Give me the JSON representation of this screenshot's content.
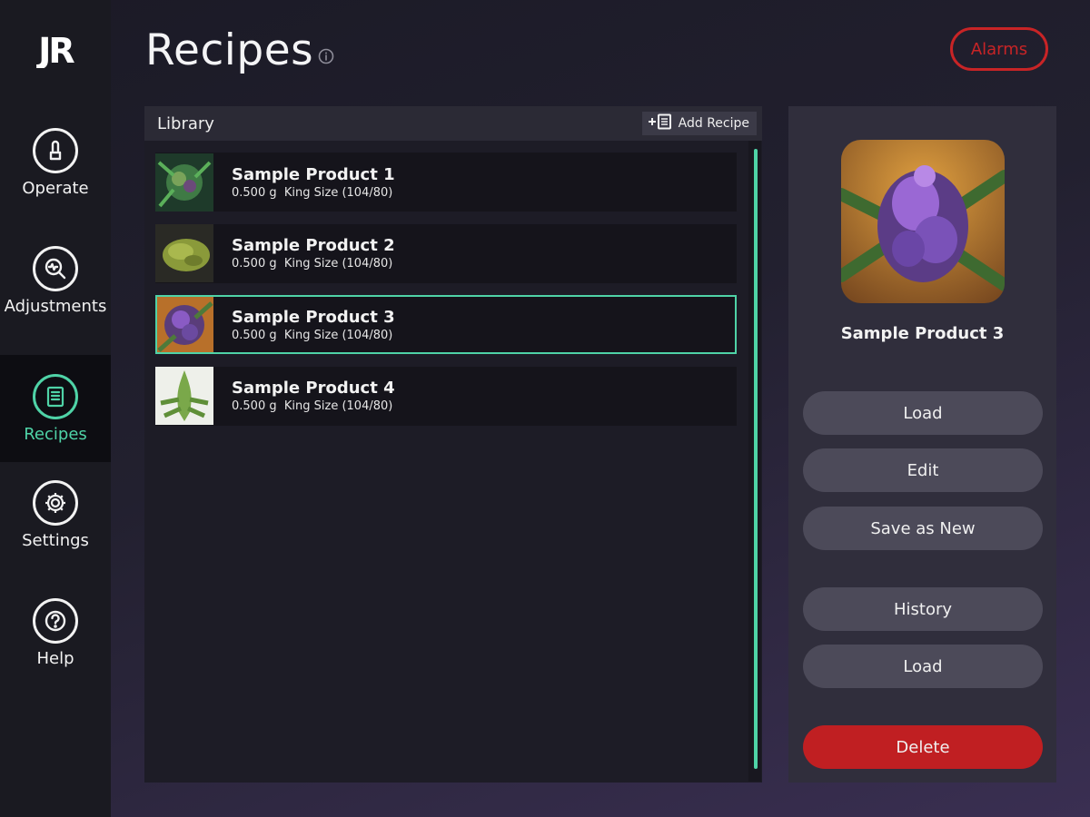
{
  "app": {
    "logo_text": "JR"
  },
  "sidebar": {
    "items": [
      {
        "label": "Operate",
        "icon": "operate-hand-icon"
      },
      {
        "label": "Adjustments",
        "icon": "adjustments-magnifier-icon"
      },
      {
        "label": "Recipes",
        "icon": "recipes-list-icon",
        "active": true
      },
      {
        "label": "Settings",
        "icon": "gear-icon"
      },
      {
        "label": "Help",
        "icon": "question-icon"
      }
    ]
  },
  "header": {
    "title": "Recipes",
    "alarms_label": "Alarms"
  },
  "library": {
    "title": "Library",
    "add_label": "Add Recipe",
    "items": [
      {
        "name": "Sample Product 1",
        "weight": "0.500 g",
        "size": "King Size (104/80)"
      },
      {
        "name": "Sample Product 2",
        "weight": "0.500 g",
        "size": "King Size (104/80)"
      },
      {
        "name": "Sample Product 3",
        "weight": "0.500 g",
        "size": "King Size (104/80)",
        "selected": true
      },
      {
        "name": "Sample Product 4",
        "weight": "0.500 g",
        "size": "King Size (104/80)"
      }
    ]
  },
  "detail": {
    "name": "Sample Product 3",
    "buttons": {
      "load": "Load",
      "edit": "Edit",
      "save_as_new": "Save as New",
      "history": "History",
      "load2": "Load",
      "delete": "Delete"
    }
  },
  "colors": {
    "accent": "#4fd3a7",
    "alarm": "#c82426",
    "delete": "#c01f22"
  }
}
